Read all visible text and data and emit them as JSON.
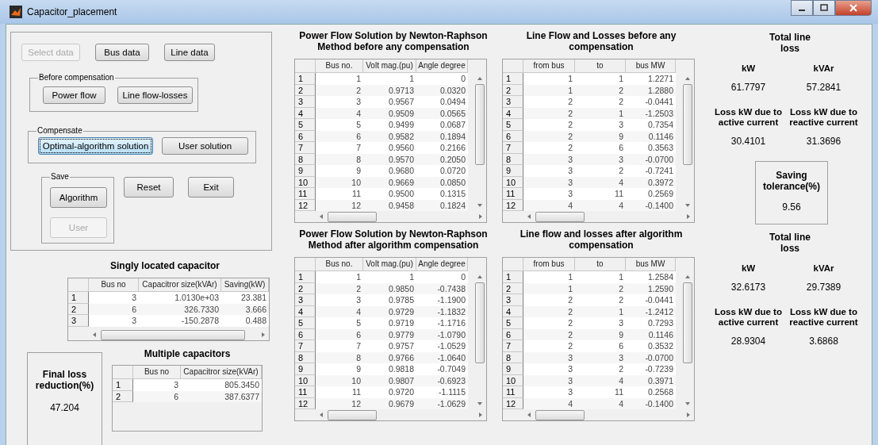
{
  "window": {
    "title": "Capacitor_placement"
  },
  "top_buttons": [
    {
      "label": "Select data",
      "disabled": true,
      "focused": false
    },
    {
      "label": "Bus data",
      "disabled": false,
      "focused": false
    },
    {
      "label": "Line data",
      "disabled": false,
      "focused": false
    }
  ],
  "before_compensation": {
    "title": "Before compensation",
    "buttons": [
      {
        "label": "Power flow",
        "disabled": false,
        "focused": false
      },
      {
        "label": "Line flow-losses",
        "disabled": false,
        "focused": false
      }
    ]
  },
  "compensate": {
    "title": "Compensate",
    "buttons": [
      {
        "label": "Optimal-algorithm solution",
        "disabled": false,
        "focused": true
      },
      {
        "label": "User solution",
        "disabled": false,
        "focused": false
      }
    ]
  },
  "save": {
    "title": "Save",
    "buttons": [
      {
        "label": "Algorithm",
        "disabled": false,
        "focused": false
      },
      {
        "label": "User",
        "disabled": true,
        "focused": false
      }
    ]
  },
  "action_buttons": [
    {
      "label": "Reset",
      "disabled": false,
      "focused": false
    },
    {
      "label": "Exit",
      "disabled": false,
      "focused": false
    }
  ],
  "singly_located": {
    "title": "Singly located capacitor",
    "columns": [
      "Bus no",
      "Capacitror size(kVAr)",
      "Saving(kW)"
    ],
    "rows": [
      {
        "header": "1",
        "cells": [
          "3",
          "1.0130e+03",
          "23.381"
        ]
      },
      {
        "header": "2",
        "cells": [
          "6",
          "326.7330",
          "3.666"
        ]
      },
      {
        "header": "3",
        "cells": [
          "3",
          "-150.2878",
          "0.488"
        ]
      }
    ]
  },
  "final_loss": {
    "title": "Final loss reduction(%)",
    "value": "47.204"
  },
  "multiple": {
    "title": "Multiple capacitors",
    "columns": [
      "Bus no",
      "Capacitror size(kVAr)"
    ],
    "rows": [
      {
        "header": "1",
        "cells": [
          "3",
          "805.3450"
        ]
      },
      {
        "header": "2",
        "cells": [
          "6",
          "387.6377"
        ]
      }
    ]
  },
  "power_flow_before": {
    "title": "Power Flow Solution by Newton-Raphson Method before any compensation",
    "columns": [
      "Bus no.",
      "Volt mag.(pu)",
      "Angle degree"
    ],
    "rows": [
      {
        "header": "1",
        "cells": [
          "1",
          "1",
          "0"
        ]
      },
      {
        "header": "2",
        "cells": [
          "2",
          "0.9713",
          "0.0320"
        ]
      },
      {
        "header": "3",
        "cells": [
          "3",
          "0.9567",
          "0.0494"
        ]
      },
      {
        "header": "4",
        "cells": [
          "4",
          "0.9509",
          "0.0565"
        ]
      },
      {
        "header": "5",
        "cells": [
          "5",
          "0.9499",
          "0.0687"
        ]
      },
      {
        "header": "6",
        "cells": [
          "6",
          "0.9582",
          "0.1894"
        ]
      },
      {
        "header": "7",
        "cells": [
          "7",
          "0.9560",
          "0.2166"
        ]
      },
      {
        "header": "8",
        "cells": [
          "8",
          "0.9570",
          "0.2050"
        ]
      },
      {
        "header": "9",
        "cells": [
          "9",
          "0.9680",
          "0.0720"
        ]
      },
      {
        "header": "10",
        "cells": [
          "10",
          "0.9669",
          "0.0850"
        ]
      },
      {
        "header": "11",
        "cells": [
          "11",
          "0.9500",
          "0.1315"
        ]
      },
      {
        "header": "12",
        "cells": [
          "12",
          "0.9458",
          "0.1824"
        ]
      }
    ]
  },
  "line_flow_before": {
    "title": "Line Flow and Losses before any compensation",
    "columns": [
      "from bus",
      "to",
      "bus MW"
    ],
    "rows": [
      {
        "header": "1",
        "cells": [
          "1",
          "1",
          "1.2271"
        ]
      },
      {
        "header": "2",
        "cells": [
          "1",
          "2",
          "1.2880"
        ]
      },
      {
        "header": "3",
        "cells": [
          "2",
          "2",
          "-0.0441"
        ]
      },
      {
        "header": "4",
        "cells": [
          "2",
          "1",
          "-1.2503"
        ]
      },
      {
        "header": "5",
        "cells": [
          "2",
          "3",
          "0.7354"
        ]
      },
      {
        "header": "6",
        "cells": [
          "2",
          "9",
          "0.1146"
        ]
      },
      {
        "header": "7",
        "cells": [
          "2",
          "6",
          "0.3563"
        ]
      },
      {
        "header": "8",
        "cells": [
          "3",
          "3",
          "-0.0700"
        ]
      },
      {
        "header": "9",
        "cells": [
          "3",
          "2",
          "-0.7241"
        ]
      },
      {
        "header": "10",
        "cells": [
          "3",
          "4",
          "0.3972"
        ]
      },
      {
        "header": "11",
        "cells": [
          "3",
          "11",
          "0.2569"
        ]
      },
      {
        "header": "12",
        "cells": [
          "4",
          "4",
          "-0.1400"
        ]
      }
    ]
  },
  "power_flow_after": {
    "title": "Power Flow Solution by Newton-Raphson Method after algorithm compensation",
    "columns": [
      "Bus no.",
      "Volt mag.(pu)",
      "Angle degree"
    ],
    "rows": [
      {
        "header": "1",
        "cells": [
          "1",
          "1",
          "0"
        ]
      },
      {
        "header": "2",
        "cells": [
          "2",
          "0.9850",
          "-0.7438"
        ]
      },
      {
        "header": "3",
        "cells": [
          "3",
          "0.9785",
          "-1.1900"
        ]
      },
      {
        "header": "4",
        "cells": [
          "4",
          "0.9729",
          "-1.1832"
        ]
      },
      {
        "header": "5",
        "cells": [
          "5",
          "0.9719",
          "-1.1716"
        ]
      },
      {
        "header": "6",
        "cells": [
          "6",
          "0.9779",
          "-1.0790"
        ]
      },
      {
        "header": "7",
        "cells": [
          "7",
          "0.9757",
          "-1.0529"
        ]
      },
      {
        "header": "8",
        "cells": [
          "8",
          "0.9766",
          "-1.0640"
        ]
      },
      {
        "header": "9",
        "cells": [
          "9",
          "0.9818",
          "-0.7049"
        ]
      },
      {
        "header": "10",
        "cells": [
          "10",
          "0.9807",
          "-0.6923"
        ]
      },
      {
        "header": "11",
        "cells": [
          "11",
          "0.9720",
          "-1.1115"
        ]
      },
      {
        "header": "12",
        "cells": [
          "12",
          "0.9679",
          "-1.0629"
        ]
      }
    ]
  },
  "line_flow_after": {
    "title": "Line flow and losses after algorithm compensation",
    "columns": [
      "from bus",
      "to",
      "bus MW"
    ],
    "rows": [
      {
        "header": "1",
        "cells": [
          "1",
          "1",
          "1.2584"
        ]
      },
      {
        "header": "2",
        "cells": [
          "1",
          "2",
          "1.2590"
        ]
      },
      {
        "header": "3",
        "cells": [
          "2",
          "2",
          "-0.0441"
        ]
      },
      {
        "header": "4",
        "cells": [
          "2",
          "1",
          "-1.2412"
        ]
      },
      {
        "header": "5",
        "cells": [
          "2",
          "3",
          "0.7293"
        ]
      },
      {
        "header": "6",
        "cells": [
          "2",
          "9",
          "0.1146"
        ]
      },
      {
        "header": "7",
        "cells": [
          "2",
          "6",
          "0.3532"
        ]
      },
      {
        "header": "8",
        "cells": [
          "3",
          "3",
          "-0.0700"
        ]
      },
      {
        "header": "9",
        "cells": [
          "3",
          "2",
          "-0.7239"
        ]
      },
      {
        "header": "10",
        "cells": [
          "3",
          "4",
          "0.3971"
        ]
      },
      {
        "header": "11",
        "cells": [
          "3",
          "11",
          "0.2568"
        ]
      },
      {
        "header": "12",
        "cells": [
          "4",
          "4",
          "-0.1400"
        ]
      }
    ]
  },
  "loss_before": {
    "title": "Total line loss",
    "kw_label": "kW",
    "kvar_label": "kVAr",
    "kw": "61.7797",
    "kvar": "57.2841",
    "active_label": "Loss kW due to active current",
    "reactive_label": "Loss kW due to reactive current",
    "active": "30.4101",
    "reactive": "31.3696"
  },
  "saving_tolerance": {
    "title": "Saving tolerance(%)",
    "value": "9.56"
  },
  "loss_after": {
    "title": "Total line loss",
    "kw_label": "kW",
    "kvar_label": "kVAr",
    "kw": "32.6173",
    "kvar": "29.7389",
    "active_label": "Loss kW due to active current",
    "reactive_label": "Loss kW due to reactive current",
    "active": "28.9304",
    "reactive": "3.6868"
  }
}
